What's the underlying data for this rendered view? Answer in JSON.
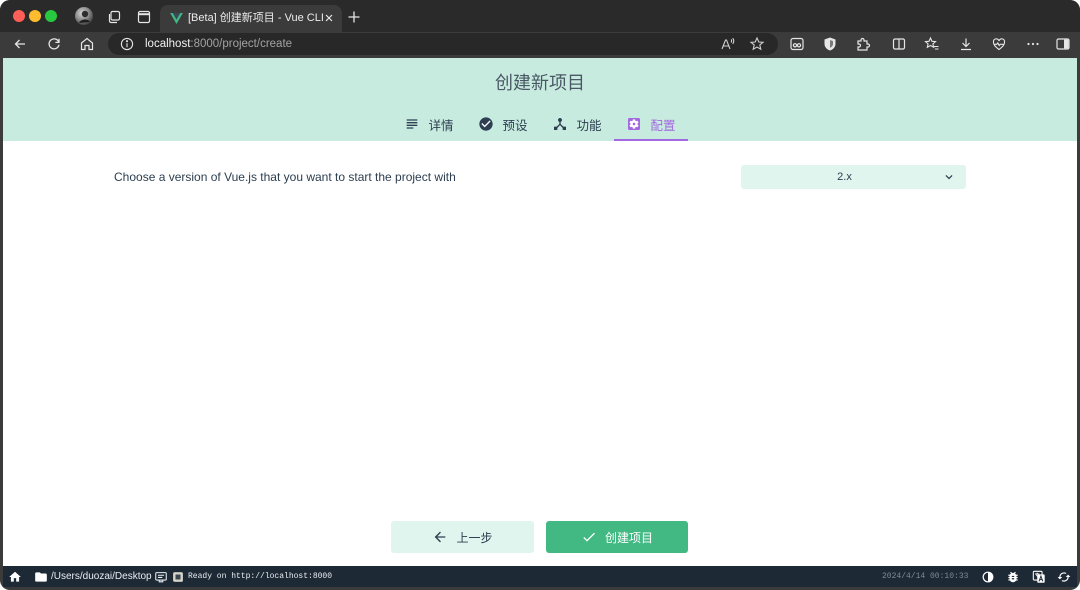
{
  "browser": {
    "tab": {
      "title": "[Beta] 创建新项目 - Vue CLI",
      "icon": "vue-logo-icon"
    },
    "address_bar": {
      "host": "localhost",
      "path": ":8000/project/create"
    }
  },
  "page": {
    "title": "创建新项目",
    "tabs": [
      {
        "label": "详情",
        "icon": "details-list-icon",
        "active": false
      },
      {
        "label": "预设",
        "icon": "check-circle-icon",
        "active": false
      },
      {
        "label": "功能",
        "icon": "device-hub-icon",
        "active": false
      },
      {
        "label": "配置",
        "icon": "settings-icon",
        "active": true
      }
    ],
    "prompt": {
      "question": "Choose a version of Vue.js that you want to start the project with",
      "selected_value": "2.x"
    },
    "actions": {
      "previous_label": "上一步",
      "create_label": "创建项目"
    }
  },
  "statusbar": {
    "cwd": "/Users/duozai/Desktop",
    "last_log": "Ready on http://localhost:8000",
    "timestamp": "2024/4/14 00:10:33"
  },
  "colors": {
    "chrome_strip": "#2a2a2a",
    "chrome_toolbar": "#3b3b3b",
    "address_field": "#282828",
    "header_bg": "#c8ebdf",
    "accent": "#a369e0",
    "primary": "#42b983",
    "primary_light": "#e0f5ed",
    "text": "#2c3e50",
    "statusbar_bg": "#1d2935"
  }
}
